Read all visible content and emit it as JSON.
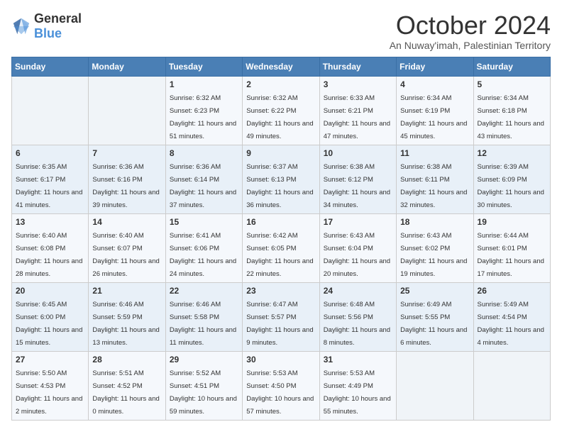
{
  "header": {
    "logo_general": "General",
    "logo_blue": "Blue",
    "month_title": "October 2024",
    "location": "An Nuway'imah, Palestinian Territory"
  },
  "days_of_week": [
    "Sunday",
    "Monday",
    "Tuesday",
    "Wednesday",
    "Thursday",
    "Friday",
    "Saturday"
  ],
  "weeks": [
    [
      {
        "day": "",
        "sunrise": "",
        "sunset": "",
        "daylight": ""
      },
      {
        "day": "",
        "sunrise": "",
        "sunset": "",
        "daylight": ""
      },
      {
        "day": "1",
        "sunrise": "Sunrise: 6:32 AM",
        "sunset": "Sunset: 6:23 PM",
        "daylight": "Daylight: 11 hours and 51 minutes."
      },
      {
        "day": "2",
        "sunrise": "Sunrise: 6:32 AM",
        "sunset": "Sunset: 6:22 PM",
        "daylight": "Daylight: 11 hours and 49 minutes."
      },
      {
        "day": "3",
        "sunrise": "Sunrise: 6:33 AM",
        "sunset": "Sunset: 6:21 PM",
        "daylight": "Daylight: 11 hours and 47 minutes."
      },
      {
        "day": "4",
        "sunrise": "Sunrise: 6:34 AM",
        "sunset": "Sunset: 6:19 PM",
        "daylight": "Daylight: 11 hours and 45 minutes."
      },
      {
        "day": "5",
        "sunrise": "Sunrise: 6:34 AM",
        "sunset": "Sunset: 6:18 PM",
        "daylight": "Daylight: 11 hours and 43 minutes."
      }
    ],
    [
      {
        "day": "6",
        "sunrise": "Sunrise: 6:35 AM",
        "sunset": "Sunset: 6:17 PM",
        "daylight": "Daylight: 11 hours and 41 minutes."
      },
      {
        "day": "7",
        "sunrise": "Sunrise: 6:36 AM",
        "sunset": "Sunset: 6:16 PM",
        "daylight": "Daylight: 11 hours and 39 minutes."
      },
      {
        "day": "8",
        "sunrise": "Sunrise: 6:36 AM",
        "sunset": "Sunset: 6:14 PM",
        "daylight": "Daylight: 11 hours and 37 minutes."
      },
      {
        "day": "9",
        "sunrise": "Sunrise: 6:37 AM",
        "sunset": "Sunset: 6:13 PM",
        "daylight": "Daylight: 11 hours and 36 minutes."
      },
      {
        "day": "10",
        "sunrise": "Sunrise: 6:38 AM",
        "sunset": "Sunset: 6:12 PM",
        "daylight": "Daylight: 11 hours and 34 minutes."
      },
      {
        "day": "11",
        "sunrise": "Sunrise: 6:38 AM",
        "sunset": "Sunset: 6:11 PM",
        "daylight": "Daylight: 11 hours and 32 minutes."
      },
      {
        "day": "12",
        "sunrise": "Sunrise: 6:39 AM",
        "sunset": "Sunset: 6:09 PM",
        "daylight": "Daylight: 11 hours and 30 minutes."
      }
    ],
    [
      {
        "day": "13",
        "sunrise": "Sunrise: 6:40 AM",
        "sunset": "Sunset: 6:08 PM",
        "daylight": "Daylight: 11 hours and 28 minutes."
      },
      {
        "day": "14",
        "sunrise": "Sunrise: 6:40 AM",
        "sunset": "Sunset: 6:07 PM",
        "daylight": "Daylight: 11 hours and 26 minutes."
      },
      {
        "day": "15",
        "sunrise": "Sunrise: 6:41 AM",
        "sunset": "Sunset: 6:06 PM",
        "daylight": "Daylight: 11 hours and 24 minutes."
      },
      {
        "day": "16",
        "sunrise": "Sunrise: 6:42 AM",
        "sunset": "Sunset: 6:05 PM",
        "daylight": "Daylight: 11 hours and 22 minutes."
      },
      {
        "day": "17",
        "sunrise": "Sunrise: 6:43 AM",
        "sunset": "Sunset: 6:04 PM",
        "daylight": "Daylight: 11 hours and 20 minutes."
      },
      {
        "day": "18",
        "sunrise": "Sunrise: 6:43 AM",
        "sunset": "Sunset: 6:02 PM",
        "daylight": "Daylight: 11 hours and 19 minutes."
      },
      {
        "day": "19",
        "sunrise": "Sunrise: 6:44 AM",
        "sunset": "Sunset: 6:01 PM",
        "daylight": "Daylight: 11 hours and 17 minutes."
      }
    ],
    [
      {
        "day": "20",
        "sunrise": "Sunrise: 6:45 AM",
        "sunset": "Sunset: 6:00 PM",
        "daylight": "Daylight: 11 hours and 15 minutes."
      },
      {
        "day": "21",
        "sunrise": "Sunrise: 6:46 AM",
        "sunset": "Sunset: 5:59 PM",
        "daylight": "Daylight: 11 hours and 13 minutes."
      },
      {
        "day": "22",
        "sunrise": "Sunrise: 6:46 AM",
        "sunset": "Sunset: 5:58 PM",
        "daylight": "Daylight: 11 hours and 11 minutes."
      },
      {
        "day": "23",
        "sunrise": "Sunrise: 6:47 AM",
        "sunset": "Sunset: 5:57 PM",
        "daylight": "Daylight: 11 hours and 9 minutes."
      },
      {
        "day": "24",
        "sunrise": "Sunrise: 6:48 AM",
        "sunset": "Sunset: 5:56 PM",
        "daylight": "Daylight: 11 hours and 8 minutes."
      },
      {
        "day": "25",
        "sunrise": "Sunrise: 6:49 AM",
        "sunset": "Sunset: 5:55 PM",
        "daylight": "Daylight: 11 hours and 6 minutes."
      },
      {
        "day": "26",
        "sunrise": "Sunrise: 5:49 AM",
        "sunset": "Sunset: 4:54 PM",
        "daylight": "Daylight: 11 hours and 4 minutes."
      }
    ],
    [
      {
        "day": "27",
        "sunrise": "Sunrise: 5:50 AM",
        "sunset": "Sunset: 4:53 PM",
        "daylight": "Daylight: 11 hours and 2 minutes."
      },
      {
        "day": "28",
        "sunrise": "Sunrise: 5:51 AM",
        "sunset": "Sunset: 4:52 PM",
        "daylight": "Daylight: 11 hours and 0 minutes."
      },
      {
        "day": "29",
        "sunrise": "Sunrise: 5:52 AM",
        "sunset": "Sunset: 4:51 PM",
        "daylight": "Daylight: 10 hours and 59 minutes."
      },
      {
        "day": "30",
        "sunrise": "Sunrise: 5:53 AM",
        "sunset": "Sunset: 4:50 PM",
        "daylight": "Daylight: 10 hours and 57 minutes."
      },
      {
        "day": "31",
        "sunrise": "Sunrise: 5:53 AM",
        "sunset": "Sunset: 4:49 PM",
        "daylight": "Daylight: 10 hours and 55 minutes."
      },
      {
        "day": "",
        "sunrise": "",
        "sunset": "",
        "daylight": ""
      },
      {
        "day": "",
        "sunrise": "",
        "sunset": "",
        "daylight": ""
      }
    ]
  ]
}
